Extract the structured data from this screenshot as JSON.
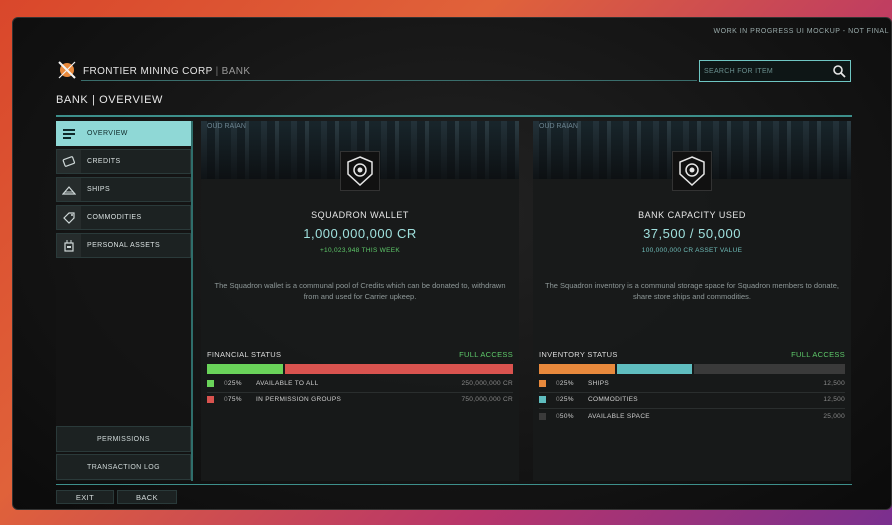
{
  "watermark": "WORK IN PROGRESS UI MOCKUP - NOT FINAL",
  "header": {
    "company": "FRONTIER MINING CORP",
    "separator": "|",
    "section": "BANK",
    "logo_icon": "mining-corp-logo-icon"
  },
  "search": {
    "placeholder": "SEARCH FOR ITEM",
    "icon": "search-icon"
  },
  "page_title": "BANK | OVERVIEW",
  "sidebar": {
    "items": [
      {
        "label": "OVERVIEW",
        "icon": "list-icon",
        "active": true
      },
      {
        "label": "CREDITS",
        "icon": "credits-icon",
        "active": false
      },
      {
        "label": "SHIPS",
        "icon": "ship-icon",
        "active": false
      },
      {
        "label": "COMMODITIES",
        "icon": "tag-icon",
        "active": false
      },
      {
        "label": "PERSONAL ASSETS",
        "icon": "robot-icon",
        "active": false
      }
    ],
    "permissions_label": "PERMISSIONS",
    "transaction_log_label": "TRANSACTION LOG"
  },
  "wallet": {
    "banner_text": "OUD RAIAN",
    "title": "SQUADRON WALLET",
    "value": "1,000,000,000 CR",
    "change": "+10,023,948 THIS WEEK",
    "description": "The Squadron wallet is a communal pool of Credits which can be donated to, withdrawn from and used for Carrier upkeep.",
    "status_label": "FINANCIAL STATUS",
    "access": "FULL ACCESS",
    "segments": [
      {
        "pct_lead": "0",
        "pct": "25%",
        "fraction": 0.25,
        "name": "AVAILABLE TO ALL",
        "amount": "250,000,000 CR",
        "color": "#6ad35a"
      },
      {
        "pct_lead": "0",
        "pct": "75%",
        "fraction": 0.75,
        "name": "IN PERMISSION GROUPS",
        "amount": "750,000,000 CR",
        "color": "#d9534f"
      }
    ]
  },
  "capacity": {
    "banner_text": "OUD RAIAN",
    "title": "BANK CAPACITY USED",
    "value": "37,500 / 50,000",
    "asset_value": "100,000,000 CR ASSET VALUE",
    "description": "The Squadron inventory is a communal storage space for Squadron members to donate, share store ships and commodities.",
    "status_label": "INVENTORY STATUS",
    "access": "FULL ACCESS",
    "segments": [
      {
        "pct_lead": "0",
        "pct": "25%",
        "fraction": 0.25,
        "name": "SHIPS",
        "amount": "12,500",
        "color": "#e8893c"
      },
      {
        "pct_lead": "0",
        "pct": "25%",
        "fraction": 0.25,
        "name": "COMMODITIES",
        "amount": "12,500",
        "color": "#5fbdbf"
      },
      {
        "pct_lead": "0",
        "pct": "50%",
        "fraction": 0.5,
        "name": "AVAILABLE SPACE",
        "amount": "25,000",
        "color": "#3a3a3a"
      }
    ]
  },
  "footer": {
    "exit_label": "EXIT",
    "back_label": "BACK"
  }
}
